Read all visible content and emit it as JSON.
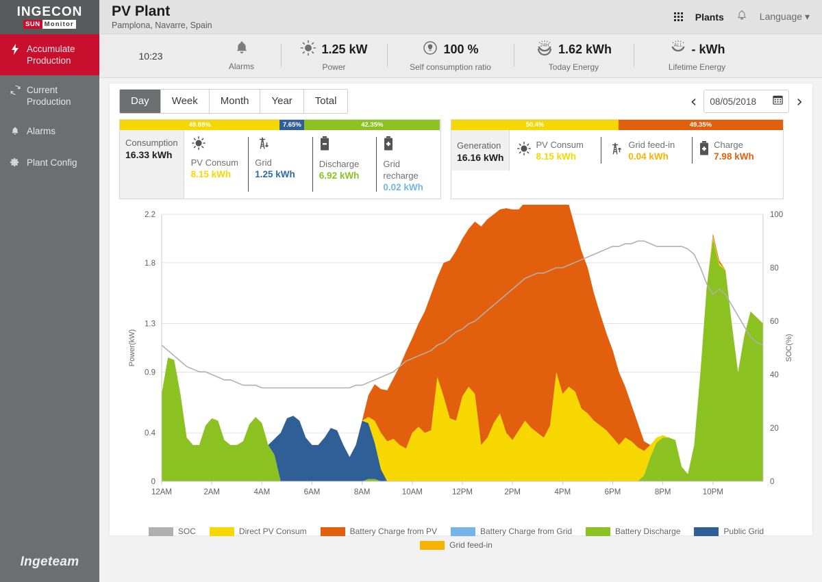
{
  "brand": {
    "logo_top": "INGECON",
    "logo_sun": "SUN",
    "logo_monitor": "Monitor",
    "footer": "Ingeteam",
    "accent_red": "#c8102e",
    "sidebar_bg": "#6d6e70"
  },
  "sidebar": {
    "items": [
      {
        "label": "Accumulate Production",
        "icon": "bolt-icon",
        "active": true
      },
      {
        "label": "Current Production",
        "icon": "refresh-icon",
        "active": false
      },
      {
        "label": "Alarms",
        "icon": "bell-icon",
        "active": false
      },
      {
        "label": "Plant Config",
        "icon": "gear-icon",
        "active": false
      }
    ]
  },
  "header": {
    "title": "PV Plant",
    "subtitle": "Pamplona, Navarre, Spain",
    "plants_label": "Plants",
    "language_label": "Language"
  },
  "statusbar": {
    "clock": "10:23",
    "stats": [
      {
        "icon": "bell-icon",
        "value": "",
        "caption": "Alarms"
      },
      {
        "icon": "sun-icon",
        "value": "1.25 kW",
        "caption": "Power"
      },
      {
        "icon": "bulb-icon",
        "value": "100 %",
        "caption": "Self consumption ratio"
      },
      {
        "icon": "gauge24h-icon",
        "value": "1.62 kWh",
        "caption": "Today Energy"
      },
      {
        "icon": "gaugeall-icon",
        "value": "- kWh",
        "caption": "Lifetime Energy"
      }
    ]
  },
  "toolbar": {
    "tabs": [
      {
        "label": "Day",
        "active": true
      },
      {
        "label": "Week",
        "active": false
      },
      {
        "label": "Month",
        "active": false
      },
      {
        "label": "Year",
        "active": false
      },
      {
        "label": "Total",
        "active": false
      }
    ],
    "prev_label": "‹",
    "next_label": "›",
    "date_value": "08/05/2018"
  },
  "consumption_panel": {
    "total_label": "Consumption",
    "total_value": "16.33 kWh",
    "bar": [
      {
        "pct_label": "49.88%",
        "pct": 49.88,
        "color": "#f6d800"
      },
      {
        "pct_label": "7.65%",
        "pct": 7.65,
        "color": "#2f5f96"
      },
      {
        "pct_label": "42.35%",
        "pct": 42.35,
        "color": "#8cc122"
      }
    ],
    "items": [
      {
        "label": "PV Consum",
        "value": "8.15 kWh",
        "color": "#f6d800",
        "icon": "sun-icon"
      },
      {
        "label": "Grid",
        "value": "1.25 kWh",
        "color": "#2f6aa8",
        "icon": "pylon-down-icon"
      },
      {
        "label": "Discharge",
        "value": "6.92 kWh",
        "color": "#8cc122",
        "icon": "battery-minus-icon"
      },
      {
        "label": "Grid recharge",
        "value": "0.02 kWh",
        "color": "#74b4e8",
        "icon": "battery-plus-icon"
      }
    ]
  },
  "generation_panel": {
    "total_label": "Generation",
    "total_value": "16.16 kWh",
    "bar": [
      {
        "pct_label": "50.4%",
        "pct": 50.4,
        "color": "#f6d800"
      },
      {
        "pct_label": "49.35%",
        "pct": 49.6,
        "color": "#e2600d"
      }
    ],
    "items": [
      {
        "label": "PV Consum",
        "value": "8.15 kWh",
        "color": "#f6d800",
        "icon": "sun-icon"
      },
      {
        "label": "Grid feed-in",
        "value": "0.04 kWh",
        "color": "#f5b400",
        "icon": "pylon-up-icon"
      },
      {
        "label": "Charge",
        "value": "7.98 kWh",
        "color": "#e2600d",
        "icon": "battery-plus-icon"
      }
    ]
  },
  "chart_data": {
    "type": "area",
    "title": "",
    "xlabel": "",
    "ylabel": "Power(kW)",
    "y2label": "SOC(%)",
    "ylim": [
      0,
      2.2
    ],
    "y2lim": [
      0,
      100
    ],
    "yticks": [
      "0",
      "0.4",
      "0.9",
      "1.3",
      "1.8",
      "2.2"
    ],
    "ytickvals": [
      0,
      0.4,
      0.9,
      1.3,
      1.8,
      2.2
    ],
    "y2ticks": [
      "0",
      "20",
      "40",
      "60",
      "80",
      "100"
    ],
    "y2tickvals": [
      0,
      20,
      40,
      60,
      80,
      100
    ],
    "grid": true,
    "legend_position": "bottom",
    "xticks": [
      "12AM",
      "2AM",
      "4AM",
      "6AM",
      "8AM",
      "10AM",
      "12PM",
      "2PM",
      "4PM",
      "6PM",
      "8PM",
      "10PM"
    ],
    "xtickvals": [
      0,
      2,
      4,
      6,
      8,
      10,
      12,
      14,
      16,
      18,
      20,
      22
    ],
    "xlim": [
      0,
      24
    ],
    "legend": [
      {
        "name": "SOC",
        "color": "#b0b0b0"
      },
      {
        "name": "Direct PV Consum",
        "color": "#f6d800"
      },
      {
        "name": "Battery Charge from PV",
        "color": "#e2600d"
      },
      {
        "name": "Battery Charge from Grid",
        "color": "#74b4e8"
      },
      {
        "name": "Battery Discharge",
        "color": "#8cc122"
      },
      {
        "name": "Public Grid",
        "color": "#2f5f96"
      },
      {
        "name": "Grid feed-in",
        "color": "#f5b400"
      }
    ],
    "x": [
      0,
      0.25,
      0.5,
      0.75,
      1,
      1.25,
      1.5,
      1.75,
      2,
      2.25,
      2.5,
      2.75,
      3,
      3.25,
      3.5,
      3.75,
      4,
      4.25,
      4.5,
      4.75,
      5,
      5.25,
      5.5,
      5.75,
      6,
      6.25,
      6.5,
      6.75,
      7,
      7.25,
      7.5,
      7.75,
      8,
      8.25,
      8.5,
      8.75,
      9,
      9.25,
      9.5,
      9.75,
      10,
      10.25,
      10.5,
      10.75,
      11,
      11.25,
      11.5,
      11.75,
      12,
      12.25,
      12.5,
      12.75,
      13,
      13.25,
      13.5,
      13.75,
      14,
      14.25,
      14.5,
      14.75,
      15,
      15.25,
      15.5,
      15.75,
      16,
      16.25,
      16.5,
      16.75,
      17,
      17.25,
      17.5,
      17.75,
      18,
      18.25,
      18.5,
      18.75,
      19,
      19.25,
      19.5,
      19.75,
      20,
      20.25,
      20.5,
      20.75,
      21,
      21.25,
      21.5,
      21.75,
      22,
      22.25,
      22.5,
      22.75,
      23,
      23.25,
      23.5,
      23.75,
      24
    ],
    "series": [
      {
        "name": "Battery Discharge",
        "color": "#8cc122",
        "values": [
          0.72,
          1.02,
          1.0,
          0.72,
          0.36,
          0.3,
          0.3,
          0.46,
          0.52,
          0.5,
          0.34,
          0.3,
          0.3,
          0.33,
          0.47,
          0.53,
          0.48,
          0.3,
          0.22,
          0.0,
          0.0,
          0.0,
          0.0,
          0.0,
          0.0,
          0.0,
          0.0,
          0.0,
          0.0,
          0.0,
          0.0,
          0.0,
          0.0,
          0.02,
          0.02,
          0.0,
          0.0,
          0.0,
          0.0,
          0.0,
          0.0,
          0.0,
          0.0,
          0.0,
          0.0,
          0.0,
          0.0,
          0.0,
          0.0,
          0.0,
          0.0,
          0.0,
          0.0,
          0.0,
          0.0,
          0.0,
          0.0,
          0.0,
          0.0,
          0.0,
          0.0,
          0.0,
          0.0,
          0.0,
          0.0,
          0.0,
          0.0,
          0.0,
          0.0,
          0.0,
          0.0,
          0.0,
          0.0,
          0.0,
          0.0,
          0.0,
          0.0,
          0.05,
          0.2,
          0.32,
          0.36,
          0.36,
          0.34,
          0.12,
          0.06,
          0.3,
          0.9,
          1.6,
          2.0,
          1.78,
          1.74,
          1.3,
          0.9,
          1.2,
          1.4,
          1.35,
          1.3
        ]
      },
      {
        "name": "Public Grid",
        "color": "#2f5f96",
        "values": [
          0.0,
          0.0,
          0.0,
          0.0,
          0.0,
          0.0,
          0.0,
          0.0,
          0.0,
          0.0,
          0.0,
          0.0,
          0.0,
          0.0,
          0.0,
          0.0,
          0.0,
          0.0,
          0.13,
          0.4,
          0.52,
          0.54,
          0.5,
          0.36,
          0.3,
          0.3,
          0.36,
          0.44,
          0.42,
          0.3,
          0.2,
          0.3,
          0.5,
          0.46,
          0.3,
          0.1,
          0.0,
          0.0,
          0.0,
          0.0,
          0.0,
          0.0,
          0.0,
          0.0,
          0.0,
          0.0,
          0.0,
          0.0,
          0.0,
          0.0,
          0.0,
          0.0,
          0.0,
          0.0,
          0.0,
          0.0,
          0.0,
          0.0,
          0.0,
          0.0,
          0.0,
          0.0,
          0.0,
          0.0,
          0.0,
          0.0,
          0.0,
          0.0,
          0.0,
          0.0,
          0.0,
          0.0,
          0.0,
          0.0,
          0.0,
          0.0,
          0.0,
          0.0,
          0.0,
          0.0,
          0.0,
          0.0,
          0.0,
          0.0,
          0.0,
          0.0,
          0.0,
          0.0,
          0.0,
          0.0,
          0.0,
          0.0,
          0.0,
          0.0,
          0.0,
          0.0,
          0.0
        ]
      },
      {
        "name": "Direct PV Consum",
        "color": "#f6d800",
        "values": [
          0.0,
          0.0,
          0.0,
          0.0,
          0.0,
          0.0,
          0.0,
          0.0,
          0.0,
          0.0,
          0.0,
          0.0,
          0.0,
          0.0,
          0.0,
          0.0,
          0.0,
          0.0,
          0.0,
          0.0,
          0.0,
          0.0,
          0.0,
          0.0,
          0.0,
          0.0,
          0.0,
          0.0,
          0.0,
          0.0,
          0.0,
          0.0,
          0.0,
          0.05,
          0.18,
          0.3,
          0.33,
          0.35,
          0.3,
          0.27,
          0.4,
          0.45,
          0.4,
          0.42,
          0.86,
          0.7,
          0.52,
          0.5,
          0.7,
          0.78,
          0.72,
          0.3,
          0.36,
          0.48,
          0.56,
          0.4,
          0.34,
          0.42,
          0.5,
          0.44,
          0.4,
          0.36,
          0.46,
          0.9,
          0.72,
          0.78,
          0.74,
          0.6,
          0.56,
          0.5,
          0.46,
          0.42,
          0.36,
          0.3,
          0.36,
          0.33,
          0.28,
          0.2,
          0.1,
          0.04,
          0.02,
          0.0,
          0.0,
          0.0,
          0.0,
          0.0,
          0.0,
          0.0,
          0.02,
          0.02,
          0.0,
          0.0,
          0.0,
          0.0,
          0.0,
          0.0,
          0.0
        ]
      },
      {
        "name": "Battery Charge from PV",
        "color": "#e2600d",
        "values": [
          0.0,
          0.0,
          0.0,
          0.0,
          0.0,
          0.0,
          0.0,
          0.0,
          0.0,
          0.0,
          0.0,
          0.0,
          0.0,
          0.0,
          0.0,
          0.0,
          0.0,
          0.0,
          0.0,
          0.0,
          0.0,
          0.0,
          0.0,
          0.0,
          0.0,
          0.0,
          0.0,
          0.0,
          0.0,
          0.0,
          0.0,
          0.0,
          0.0,
          0.18,
          0.3,
          0.36,
          0.42,
          0.5,
          0.65,
          0.8,
          0.78,
          0.85,
          1.0,
          1.12,
          0.82,
          1.1,
          1.3,
          1.4,
          1.3,
          1.3,
          1.42,
          1.8,
          1.8,
          1.72,
          1.68,
          1.85,
          1.9,
          1.82,
          1.8,
          1.85,
          1.9,
          1.92,
          1.82,
          1.4,
          1.6,
          1.5,
          1.35,
          1.3,
          1.2,
          1.05,
          0.92,
          0.8,
          0.72,
          0.6,
          0.42,
          0.3,
          0.2,
          0.08,
          0.0,
          0.0,
          0.0,
          0.0,
          0.0,
          0.0,
          0.0,
          0.0,
          0.0,
          0.0,
          0.02,
          0.02,
          0.0,
          0.0,
          0.0,
          0.0,
          0.0,
          0.0,
          0.0
        ]
      }
    ],
    "soc": {
      "name": "SOC",
      "color": "#b0b0b0",
      "values": [
        51,
        49,
        47,
        45,
        43,
        42,
        41,
        41,
        40,
        39,
        38,
        38,
        37,
        36,
        36,
        36,
        35,
        35,
        35,
        35,
        35,
        35,
        35,
        35,
        35,
        35,
        35,
        35,
        35,
        35,
        35,
        36,
        36,
        37,
        38,
        39,
        40,
        41,
        43,
        45,
        46,
        47,
        48,
        49,
        51,
        52,
        54,
        56,
        57,
        59,
        60,
        62,
        64,
        66,
        68,
        70,
        72,
        74,
        76,
        77,
        78,
        78,
        79,
        80,
        80,
        81,
        82,
        83,
        84,
        85,
        86,
        87,
        88,
        88,
        89,
        89,
        90,
        90,
        89,
        88,
        88,
        88,
        88,
        88,
        87,
        85,
        80,
        74,
        70,
        72,
        70,
        66,
        62,
        58,
        54,
        52,
        51
      ]
    }
  }
}
